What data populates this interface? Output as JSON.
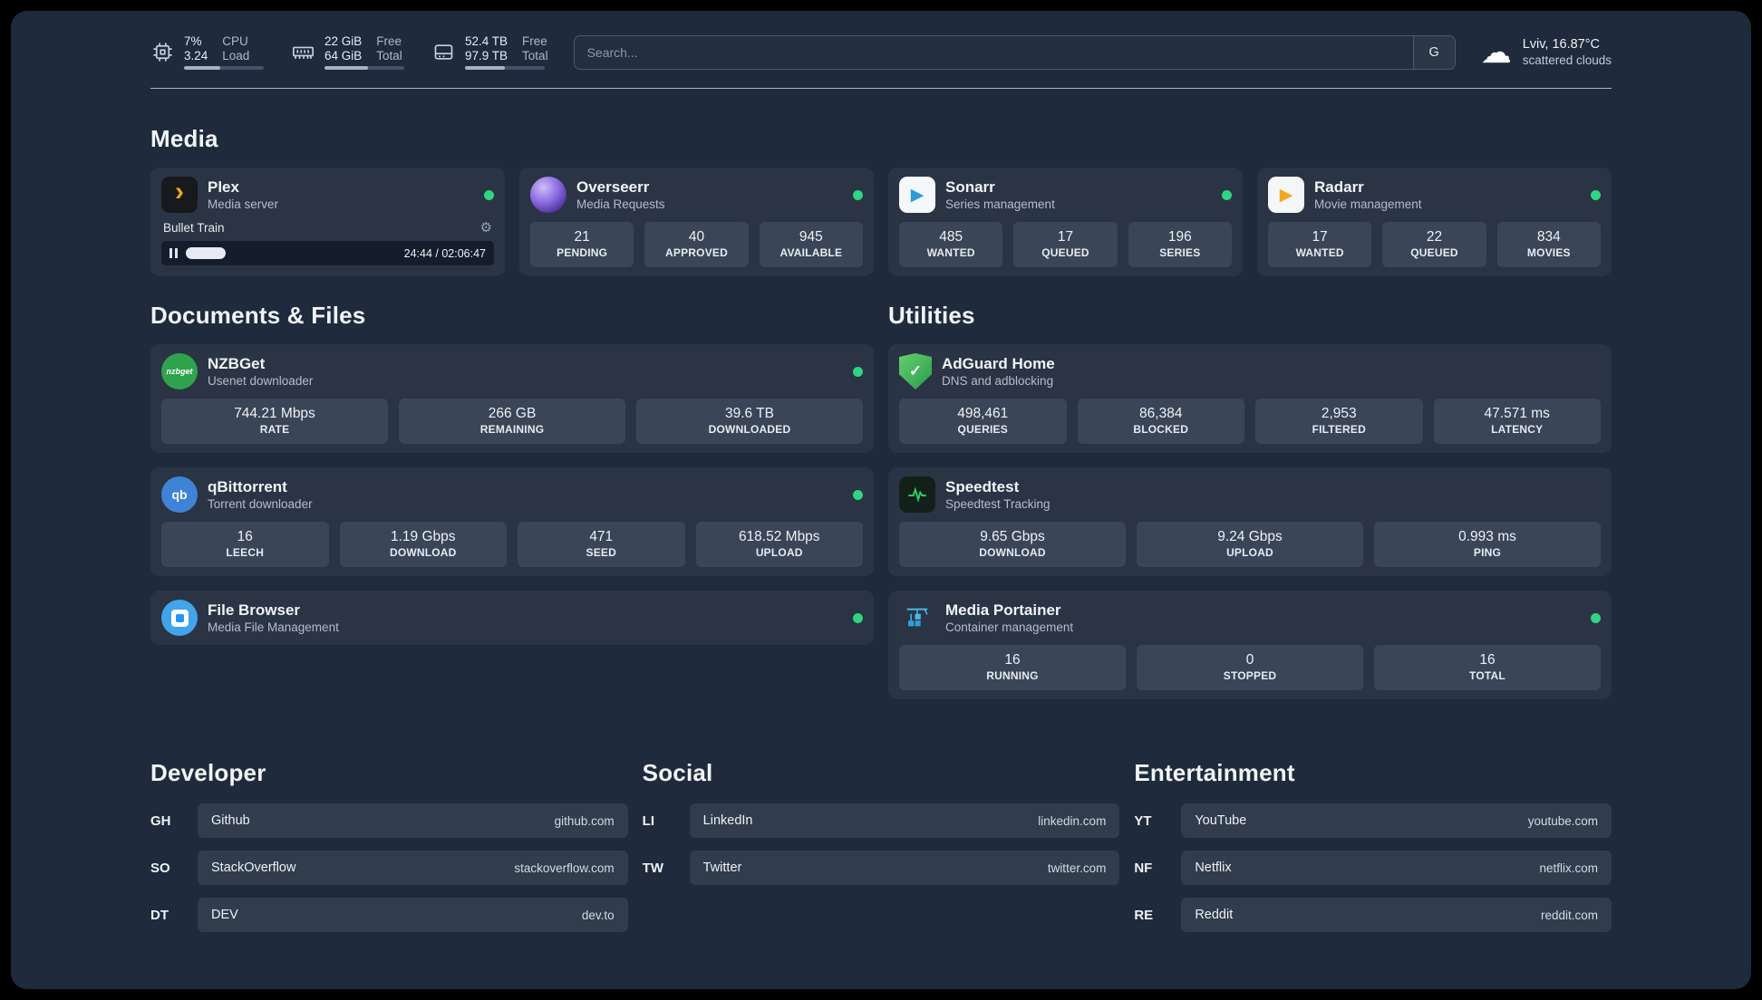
{
  "colors": {
    "background": "#1f2a3c",
    "card": "#2a3444",
    "stat_box": "#3a4557",
    "status_online": "#2fd57f",
    "plex_amber": "#edaa13",
    "radarr_amber": "#f2a71c",
    "sonarr_blue": "#2f9ad8",
    "qbittorrent_blue": "#3e83d6",
    "nzbget_green": "#2fa34c",
    "adguard_green": "#2b9b4c",
    "overseerr_purple": "#8a6ae0",
    "portainer_blue": "#2d9fd8",
    "speedtest_green": "#2fcf67"
  },
  "icons": {
    "plex_glyph": "›",
    "sonarr_glyph": "▶",
    "radarr_glyph": "▶",
    "nzbget_glyph": "nzbget",
    "qbittorrent_glyph": "qb",
    "adguard_glyph": "✓",
    "gear_glyph": "⚙",
    "cloud_glyph": "☁"
  },
  "topbar": {
    "cpu": {
      "value": "7%",
      "sub": "3.24",
      "label_top": "CPU",
      "label_bottom": "Load",
      "bar_percent": 45
    },
    "ram": {
      "value": "22 GiB",
      "sub": "64 GiB",
      "label_top": "Free",
      "label_bottom": "Total",
      "bar_percent": 55
    },
    "disk": {
      "value": "52.4 TB",
      "sub": "97.9 TB",
      "label_top": "Free",
      "label_bottom": "Total",
      "bar_percent": 50
    },
    "search": {
      "placeholder": "Search...",
      "engine_label": "G"
    },
    "weather": {
      "location": "Lviv, 16.87°C",
      "condition": "scattered clouds"
    }
  },
  "sections": {
    "media": "Media",
    "documents": "Documents & Files",
    "utilities": "Utilities",
    "developer": "Developer",
    "social": "Social",
    "entertainment": "Entertainment"
  },
  "media": {
    "cards": [
      {
        "name": "Plex",
        "desc": "Media server",
        "online": true,
        "player": {
          "track": "Bullet Train",
          "time": "24:44 / 02:06:47",
          "progress": 19
        }
      },
      {
        "name": "Overseerr",
        "desc": "Media Requests",
        "online": true,
        "stats": [
          {
            "value": "21",
            "label": "PENDING"
          },
          {
            "value": "40",
            "label": "APPROVED"
          },
          {
            "value": "945",
            "label": "AVAILABLE"
          }
        ]
      },
      {
        "name": "Sonarr",
        "desc": "Series management",
        "online": true,
        "stats": [
          {
            "value": "485",
            "label": "WANTED"
          },
          {
            "value": "17",
            "label": "QUEUED"
          },
          {
            "value": "196",
            "label": "SERIES"
          }
        ]
      },
      {
        "name": "Radarr",
        "desc": "Movie management",
        "online": true,
        "stats": [
          {
            "value": "17",
            "label": "WANTED"
          },
          {
            "value": "22",
            "label": "QUEUED"
          },
          {
            "value": "834",
            "label": "MOVIES"
          }
        ]
      }
    ]
  },
  "documents": {
    "cards": [
      {
        "name": "NZBGet",
        "desc": "Usenet downloader",
        "online": true,
        "stats": [
          {
            "value": "744.21 Mbps",
            "label": "RATE"
          },
          {
            "value": "266 GB",
            "label": "REMAINING"
          },
          {
            "value": "39.6 TB",
            "label": "DOWNLOADED"
          }
        ]
      },
      {
        "name": "qBittorrent",
        "desc": "Torrent downloader",
        "online": true,
        "stats": [
          {
            "value": "16",
            "label": "LEECH"
          },
          {
            "value": "1.19 Gbps",
            "label": "DOWNLOAD"
          },
          {
            "value": "471",
            "label": "SEED"
          },
          {
            "value": "618.52 Mbps",
            "label": "UPLOAD"
          }
        ]
      },
      {
        "name": "File Browser",
        "desc": "Media File Management",
        "online": true
      }
    ]
  },
  "utilities": {
    "cards": [
      {
        "name": "AdGuard Home",
        "desc": "DNS and adblocking",
        "online": false,
        "stats": [
          {
            "value": "498,461",
            "label": "QUERIES"
          },
          {
            "value": "86,384",
            "label": "BLOCKED"
          },
          {
            "value": "2,953",
            "label": "FILTERED"
          },
          {
            "value": "47.571 ms",
            "label": "LATENCY"
          }
        ]
      },
      {
        "name": "Speedtest",
        "desc": "Speedtest Tracking",
        "online": false,
        "stats": [
          {
            "value": "9.65 Gbps",
            "label": "DOWNLOAD"
          },
          {
            "value": "9.24 Gbps",
            "label": "UPLOAD"
          },
          {
            "value": "0.993 ms",
            "label": "PING"
          }
        ]
      },
      {
        "name": "Media Portainer",
        "desc": "Container management",
        "online": true,
        "stats": [
          {
            "value": "16",
            "label": "RUNNING"
          },
          {
            "value": "0",
            "label": "STOPPED"
          },
          {
            "value": "16",
            "label": "TOTAL"
          }
        ]
      }
    ]
  },
  "bookmarks": {
    "developer": [
      {
        "abbr": "GH",
        "name": "Github",
        "url": "github.com"
      },
      {
        "abbr": "SO",
        "name": "StackOverflow",
        "url": "stackoverflow.com"
      },
      {
        "abbr": "DT",
        "name": "DEV",
        "url": "dev.to"
      }
    ],
    "social": [
      {
        "abbr": "LI",
        "name": "LinkedIn",
        "url": "linkedin.com"
      },
      {
        "abbr": "TW",
        "name": "Twitter",
        "url": "twitter.com"
      }
    ],
    "entertainment": [
      {
        "abbr": "YT",
        "name": "YouTube",
        "url": "youtube.com"
      },
      {
        "abbr": "NF",
        "name": "Netflix",
        "url": "netflix.com"
      },
      {
        "abbr": "RE",
        "name": "Reddit",
        "url": "reddit.com"
      }
    ]
  }
}
